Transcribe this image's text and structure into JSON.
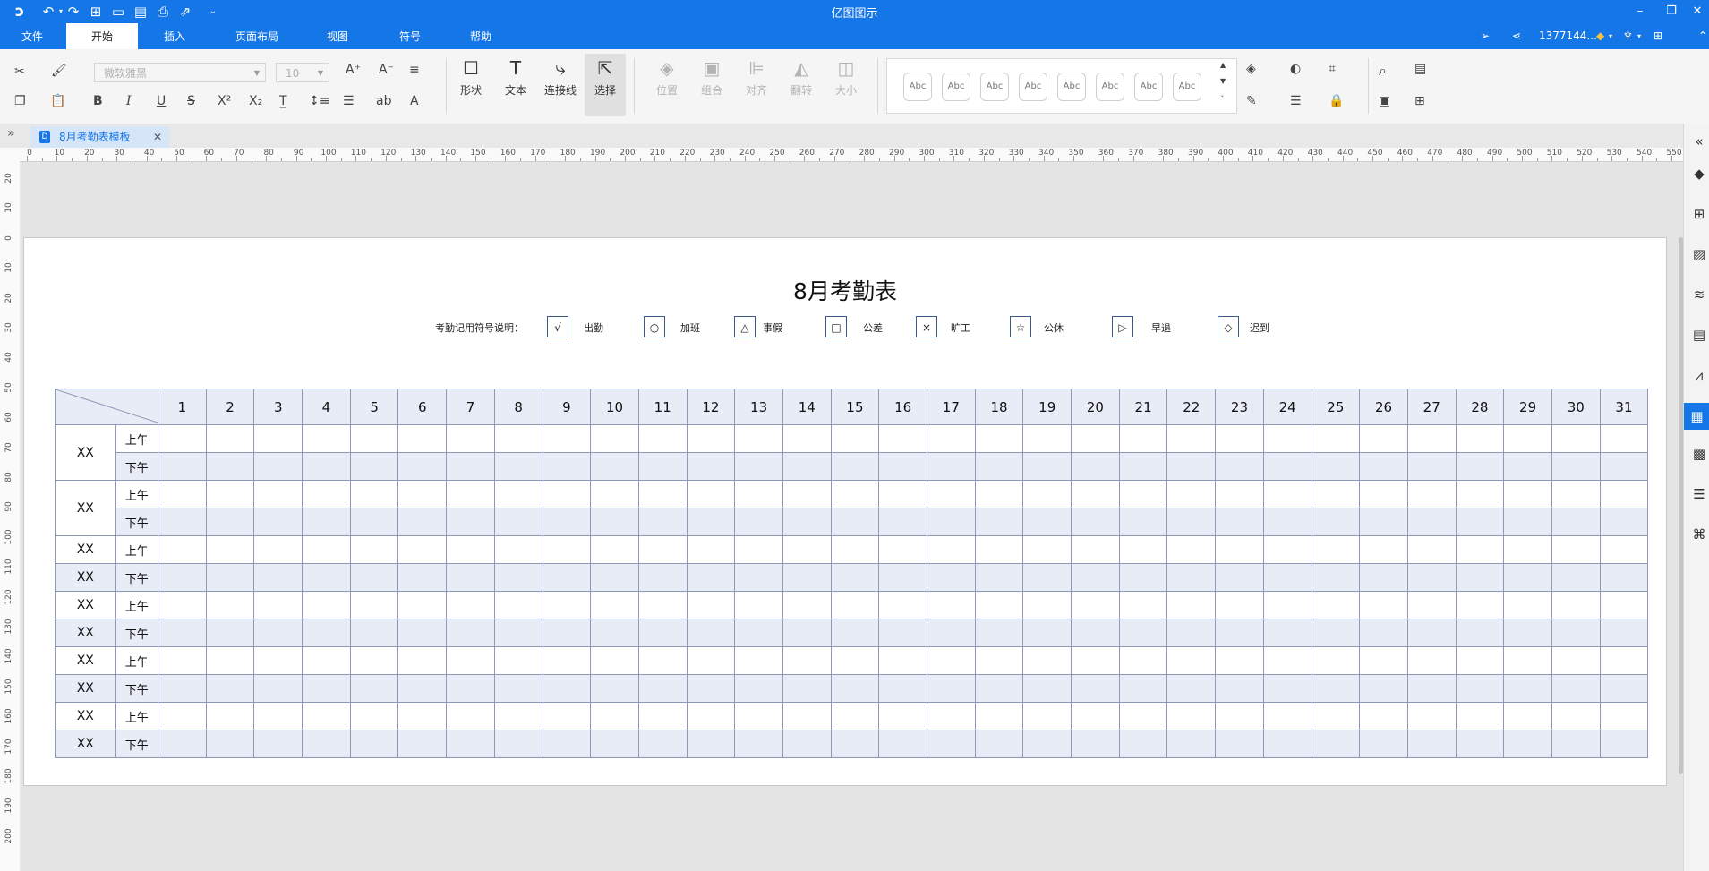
{
  "app": {
    "title": "亿图图示",
    "user": "1377144...",
    "quick_icons": [
      "logo-icon",
      "undo-icon",
      "redo-icon",
      "new-file-icon",
      "open-folder-icon",
      "save-icon",
      "print-icon",
      "export-icon",
      "more-icon"
    ]
  },
  "menu": {
    "tabs": [
      "文件",
      "开始",
      "插入",
      "页面布局",
      "视图",
      "符号",
      "帮助"
    ],
    "active": "开始"
  },
  "ribbon": {
    "font_name": "微软雅黑",
    "font_size": "10",
    "big_buttons": [
      {
        "label": "形状",
        "glyph": "☐",
        "enabled": true
      },
      {
        "label": "文本",
        "glyph": "T",
        "enabled": true
      },
      {
        "label": "连接线",
        "glyph": "⤷",
        "enabled": true
      },
      {
        "label": "选择",
        "glyph": "⇱",
        "enabled": true
      }
    ],
    "arrange_buttons": [
      {
        "label": "位置",
        "glyph": "◈"
      },
      {
        "label": "组合",
        "glyph": "▣"
      },
      {
        "label": "对齐",
        "glyph": "⊫"
      },
      {
        "label": "翻转",
        "glyph": "◭"
      },
      {
        "label": "大小",
        "glyph": "◫"
      }
    ],
    "style_swatch": "Abc"
  },
  "document_tab": {
    "name": "8月考勤表模板",
    "icon": "D"
  },
  "ruler": {
    "h_labels": [
      "0",
      "10",
      "20",
      "30",
      "40",
      "50",
      "60",
      "70",
      "80",
      "90",
      "100",
      "110",
      "120",
      "130",
      "140",
      "150",
      "160",
      "170",
      "180",
      "190",
      "200",
      "210",
      "220",
      "230",
      "240",
      "250",
      "260",
      "270",
      "280",
      "290",
      "300",
      "310",
      "320",
      "330",
      "340",
      "350",
      "360",
      "370",
      "380",
      "390",
      "400",
      "410",
      "420",
      "430",
      "440",
      "450",
      "460",
      "470",
      "480",
      "490",
      "500",
      "510",
      "520",
      "530",
      "540",
      "550"
    ],
    "v_labels": [
      "20",
      "10",
      "0",
      "10",
      "20",
      "30",
      "40",
      "50",
      "60",
      "70",
      "80",
      "90",
      "100",
      "110",
      "120",
      "130",
      "140",
      "150",
      "160",
      "170",
      "180",
      "190",
      "200"
    ]
  },
  "sheet": {
    "title": "8月考勤表",
    "legend_label": "考勤记用符号说明：",
    "legend": [
      {
        "symbol": "√",
        "label": "出勤"
      },
      {
        "symbol": "○",
        "label": "加班"
      },
      {
        "symbol": "△",
        "label": "事假"
      },
      {
        "symbol": "□",
        "label": "公差"
      },
      {
        "symbol": "×",
        "label": "旷工"
      },
      {
        "symbol": "☆",
        "label": "公休"
      },
      {
        "symbol": "▷",
        "label": "早退"
      },
      {
        "symbol": "◇",
        "label": "迟到"
      }
    ],
    "days": [
      "1",
      "2",
      "3",
      "4",
      "5",
      "6",
      "7",
      "8",
      "9",
      "10",
      "11",
      "12",
      "13",
      "14",
      "15",
      "16",
      "17",
      "18",
      "19",
      "20",
      "21",
      "22",
      "23",
      "24",
      "25",
      "26",
      "27",
      "28",
      "29",
      "30",
      "31"
    ],
    "rows": [
      {
        "name": "XX",
        "period": "上午",
        "merged": true
      },
      {
        "name": "",
        "period": "下午",
        "merged": true
      },
      {
        "name": "XX",
        "period": "上午",
        "merged": true
      },
      {
        "name": "",
        "period": "下午",
        "merged": true
      },
      {
        "name": "XX",
        "period": "上午"
      },
      {
        "name": "XX",
        "period": "下午"
      },
      {
        "name": "XX",
        "period": "上午"
      },
      {
        "name": "XX",
        "period": "下午"
      },
      {
        "name": "XX",
        "period": "上午"
      },
      {
        "name": "XX",
        "period": "下午"
      },
      {
        "name": "XX",
        "period": "上午"
      },
      {
        "name": "XX",
        "period": "下午"
      }
    ]
  },
  "colors": {
    "brand": "#1476e7",
    "table_shade": "#e8ecf7",
    "table_border": "#8e9ab5"
  }
}
